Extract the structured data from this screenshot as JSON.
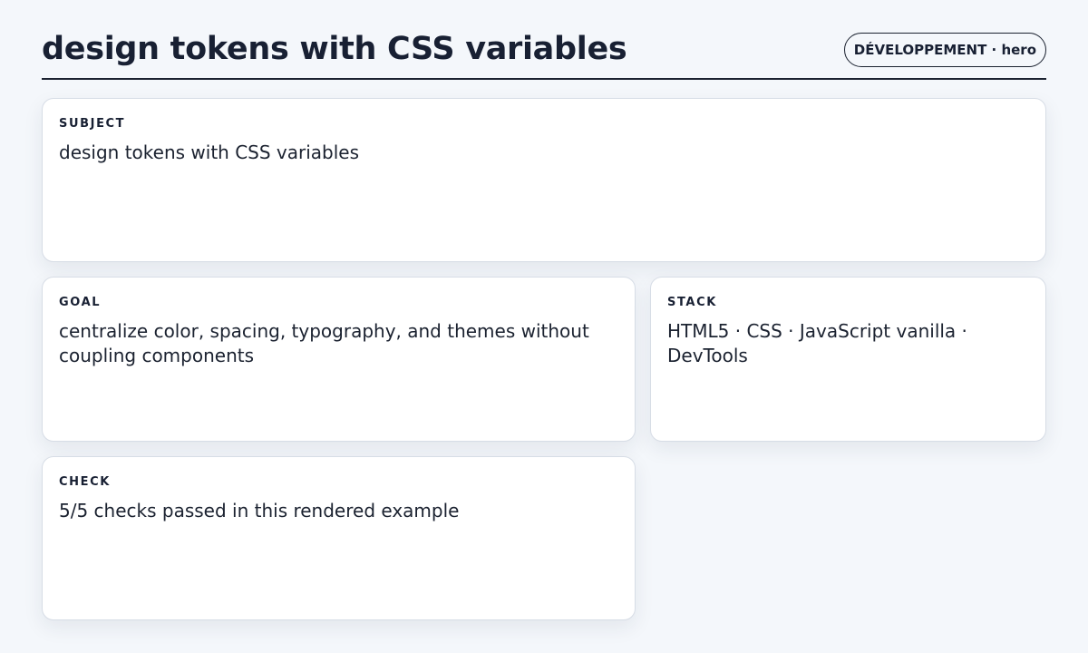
{
  "header": {
    "title": "design tokens with CSS variables",
    "badge": "DÉVELOPPEMENT · hero"
  },
  "cards": [
    {
      "label": "SUBJECT",
      "value": "design tokens with CSS variables"
    },
    {
      "label": "GOAL",
      "value": "centralize color, spacing, typography, and themes without coupling components"
    },
    {
      "label": "STACK",
      "value": "HTML5 · CSS · JavaScript vanilla · DevTools"
    },
    {
      "label": "CHECK",
      "value": "5/5 checks passed in this rendered example"
    }
  ]
}
